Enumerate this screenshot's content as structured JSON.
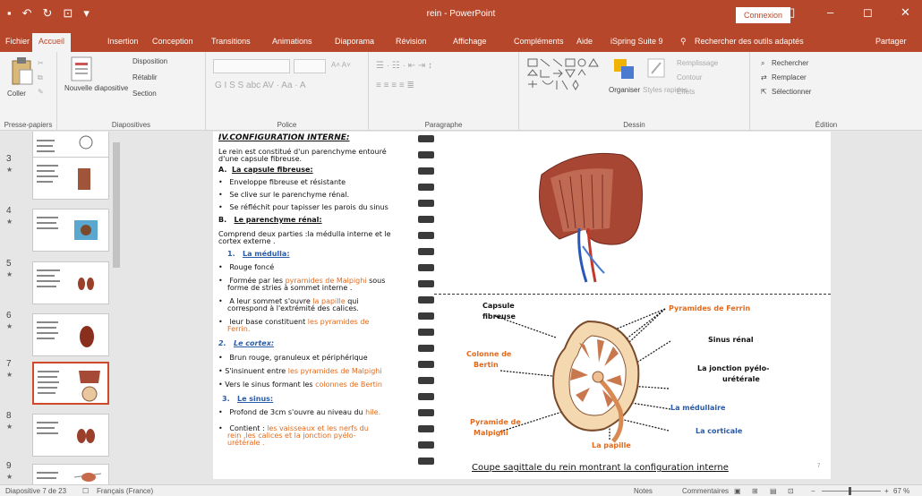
{
  "app": {
    "doc_title": "rein - PowerPoint",
    "connexion_label": "Connexion"
  },
  "menu": {
    "items": [
      "Fichier",
      "Accueil",
      "Insertion",
      "Conception",
      "Transitions",
      "Animations",
      "Diaporama",
      "Révision",
      "Affichage",
      "Compléments",
      "Aide",
      "iSpring Suite 9",
      "Recherecher des outils adaptés",
      "Partager"
    ],
    "search_label": "Rechercher des outils adaptés",
    "share_label": "Partager"
  },
  "ribbon": {
    "presse_papiers": {
      "label": "Presse-papiers",
      "paste": "Coller"
    },
    "diapositives": {
      "label": "Diapositives",
      "new_slide": "Nouvelle diapositive",
      "layout": "Disposition",
      "reset": "Rétablir",
      "section": "Section"
    },
    "police": {
      "label": "Police"
    },
    "paragraphe": {
      "label": "Paragraphe"
    },
    "dessin": {
      "label": "Dessin",
      "organize": "Organiser",
      "styles": "Styles rapides",
      "fill": "Remplissage",
      "outline": "Contour",
      "effects": "Effets"
    },
    "edition": {
      "label": "Édition",
      "find": "Rechercher",
      "replace": "Remplacer",
      "select": "Sélectionner"
    }
  },
  "thumbnails": [
    {
      "num": "3"
    },
    {
      "num": "4"
    },
    {
      "num": "5"
    },
    {
      "num": "6"
    },
    {
      "num": "7"
    },
    {
      "num": "8"
    },
    {
      "num": "9"
    }
  ],
  "slide": {
    "lines": {
      "title": "IV.CONFIGURATION INTERNE:",
      "intro1": "Le rein est constitué d'un parenchyme entouré",
      "intro2": "d'une capsule fibreuse.",
      "secA": "La capsule fibreuse:",
      "a1": "Enveloppe fibreuse et résistante",
      "a2": "Se clive sur le parenchyme rénal.",
      "a3": "Se réfléchit pour tapisser les parois du sinus",
      "secB": "Le parenchyme rénal:",
      "b1": "Comprend deux parties :la médulla interne et le",
      "b2": "cortex externe .",
      "sec1": "La médulla:",
      "m1": "Rouge foncé",
      "m2a": "Formée par les",
      "m2b": "pyramides de Malpighi",
      "m2c": "sous",
      "m2d": "forme de stries à sommet interne .",
      "m3a": "A leur sommet s'ouvre",
      "m3b": "la papille",
      "m3c": "qui",
      "m3d": "correspond à l'extrémité des calices.",
      "m4a": "leur base constituent",
      "m4b": "les pyramides de",
      "m4c": "Ferrin.",
      "sec2": "Le cortex:",
      "c1": "Brun rouge, granuleux et périphérique",
      "c2a": "S'insinuent entre",
      "c2b": "les pyramides de Malpighi",
      "c3a": "Vers le sinus formant les",
      "c3b": "colonnes de Bertin",
      "sec3": "Le sinus:",
      "s1a": "Profond de 3cm s'ouvre au niveau du",
      "s1b": "hile.",
      "s2a": "Contient :",
      "s2b": "les vaisseaux et les nerfs du",
      "s2c": "rein ,les calices et la jonction pyélo-",
      "s2d": "urétérale ."
    },
    "labels": {
      "capsule": "Capsule",
      "fibreuse": "fibreuse",
      "colonne1": "Colonne de",
      "colonne2": "Bertin",
      "pyramide1": "Pyramide de",
      "pyramide2": "Malpighi",
      "ferrin": "Pyramides de Ferrin",
      "sinus": "Sinus rénal",
      "jonction1": "La jonction pyélo-",
      "jonction2": "urétérale",
      "medullaire": "La médullaire",
      "corticale": "La corticale",
      "papille": "La papille"
    },
    "caption": "Coupe sagittale du rein montrant la configuration interne",
    "page_num": "7"
  },
  "status": {
    "slide_info": "Diapositive 7 de 23",
    "language": "Français (France)",
    "notes": "Notes",
    "comments": "Commentaires",
    "zoom": "67 %"
  },
  "colors": {
    "accent": "#b7472a",
    "orange_text": "#e46a1c",
    "blue_label": "#2a5ba8"
  }
}
